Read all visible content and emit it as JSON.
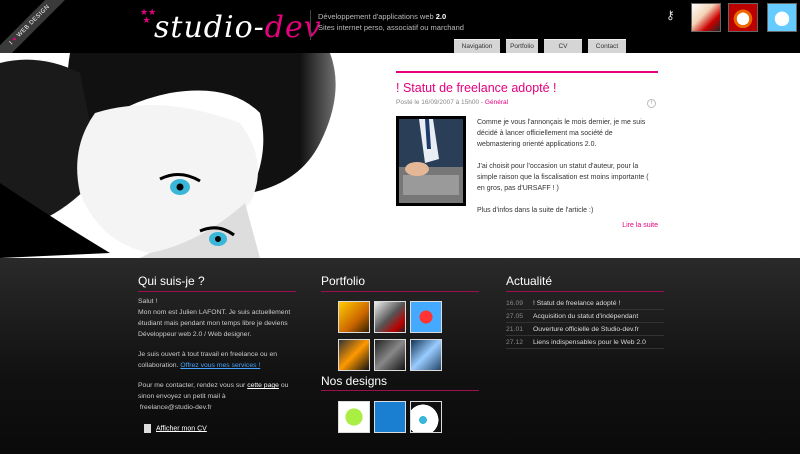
{
  "header": {
    "ribbon": "WEB DESIGN",
    "ribbon_prefix": "I",
    "logo_left": "studio-",
    "logo_right": "dev",
    "tagline_prefix": "Développement d'applications web",
    "tagline_version": "2.0",
    "tagline_line2": "Sites internet perso, associatif ou marchand"
  },
  "nav": [
    {
      "label": "Navigation"
    },
    {
      "label": "Portfolio"
    },
    {
      "label": "CV"
    },
    {
      "label": "Contact"
    }
  ],
  "post": {
    "title": "! Statut de freelance adopté !",
    "meta_prefix": "Posté le 16/09/2007 à 15h00 -",
    "category": "Général",
    "para1": "Comme je vous l'annonçais le mois dernier, je me suis décidé à lancer officiellement ma société de webmastering orienté applications 2.0.",
    "para2": "J'ai choisit pour l'occasion un statut d'auteur, pour la simple raison que la fiscalisation est moins importante ( en gros, pas d'URSAFF ! )",
    "para3": "Plus d'infos dans la suite de l'article :)",
    "read_more": "Lire la suite"
  },
  "about": {
    "heading": "Qui suis-je ?",
    "greeting": "Salut !",
    "bio": "Mon nom est Julien LAFONT. Je suis actuellement étudiant mais pendant mon temps libre je deviens Développeur web 2.0 / Web designer.",
    "freelance_text": "Je suis ouvert à tout travail en freelance ou en collaboration.",
    "services_link": "Offrez vous mes services !",
    "contact_prefix": "Pour me contacter, rendez vous sur",
    "contact_link": "cette page",
    "contact_suffix": "ou sinon envoyez un petit mail à",
    "email": "freelance@studio-dev.fr",
    "cv_label": "Afficher mon CV"
  },
  "portfolio": {
    "heading": "Portfolio",
    "designs_heading": "Nos designs"
  },
  "news": {
    "heading": "Actualité",
    "items": [
      {
        "date": "16.09",
        "title": "! Statut de freelance adopté !"
      },
      {
        "date": "27.05",
        "title": "Acquisition du statut d'indépendant"
      },
      {
        "date": "21.01",
        "title": "Ouverture officielle de Studio-dev.fr"
      },
      {
        "date": "27.12",
        "title": "Liens indispensables pour le Web 2.0"
      }
    ]
  },
  "colors": {
    "accent": "#e6007e",
    "link": "#49a4ff"
  }
}
